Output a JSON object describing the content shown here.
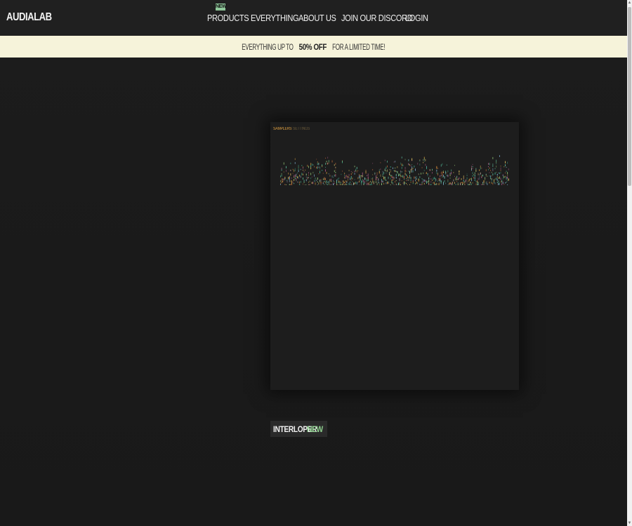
{
  "brand": {
    "logo": "AUDIALAB"
  },
  "nav": {
    "new_badge": "NEW",
    "items": [
      "PRODUCTS",
      "EVERYTHING",
      "ABOUT US",
      "JOIN OUR DISCORD",
      "LOGIN"
    ]
  },
  "promo": {
    "prefix": "EVERYTHING UP TO ",
    "highlight": "50% OFF",
    "suffix": " FOR A LIMITED TIME!"
  },
  "product_preview": {
    "tabs": [
      "SAMPLERS",
      "SETTINGS"
    ],
    "active_tab": "SAMPLERS"
  },
  "product": {
    "name": "INTERLOPER",
    "tag": "NEW"
  },
  "colors": {
    "accent_new": "#8fd08f",
    "promo_bg": "#f6f3da",
    "background": "#1b1b1b",
    "tab_active": "#e0a040"
  }
}
